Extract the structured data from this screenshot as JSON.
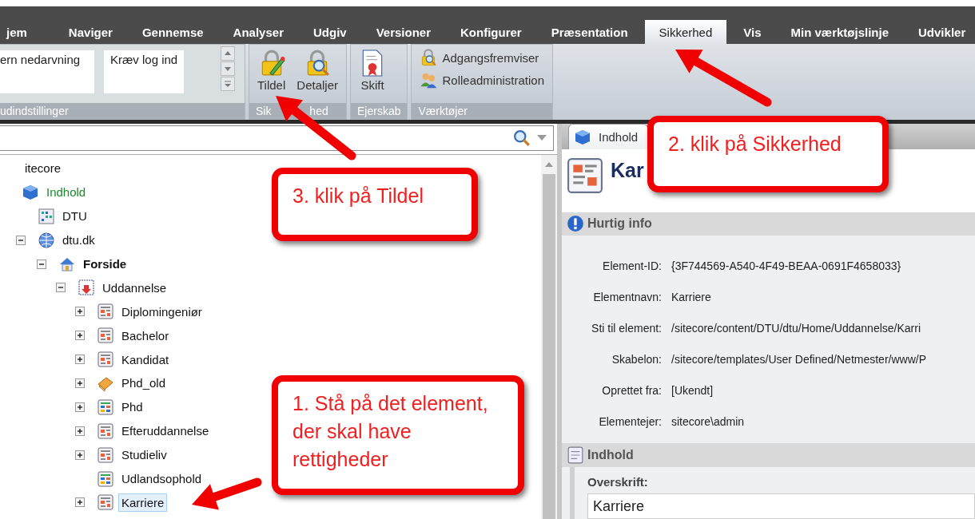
{
  "menu_tabs": [
    {
      "label": "jem",
      "selected": false
    },
    {
      "label": "Naviger",
      "selected": false
    },
    {
      "label": "Gennemse",
      "selected": false
    },
    {
      "label": "Analyser",
      "selected": false
    },
    {
      "label": "Udgiv",
      "selected": false
    },
    {
      "label": "Versioner",
      "selected": false
    },
    {
      "label": "Konfigurer",
      "selected": false
    },
    {
      "label": "Præsentation",
      "selected": false
    },
    {
      "label": "Sikkerhed",
      "selected": true
    },
    {
      "label": "Vis",
      "selected": false
    },
    {
      "label": "Min værktøjslinje",
      "selected": false
    },
    {
      "label": "Udvikler",
      "selected": false
    }
  ],
  "ribbon": {
    "gallery": {
      "items": [
        "ern nedarvning",
        "Kræv log ind"
      ],
      "group_label": "udindstillinger"
    },
    "groups": [
      {
        "label": "Sik",
        "label_end": "hed",
        "kind": "large",
        "buttons": [
          {
            "label": "Tildel",
            "kind": "lock-pencil"
          },
          {
            "label": "Detaljer",
            "kind": "lock-search"
          }
        ]
      },
      {
        "label": "Ejerskab",
        "kind": "large",
        "buttons": [
          {
            "label": "Skift",
            "kind": "certificate"
          }
        ]
      },
      {
        "label": "Værktøjer",
        "kind": "small",
        "buttons": [
          {
            "label": "Adgangsfremviser",
            "kind": "lock-search"
          },
          {
            "label": "Rolleadministration",
            "kind": "people"
          }
        ]
      }
    ]
  },
  "tree": [
    {
      "label": "itecore",
      "selected": false,
      "children": [
        {
          "label": "Indhold",
          "kind": "cube",
          "selected": false,
          "children": [
            {
              "label": "DTU",
              "kind": "grid",
              "selected": false
            },
            {
              "label": "dtu.dk",
              "kind": "globe",
              "expanded": true,
              "selected": false,
              "children": [
                {
                  "label": "Forside",
                  "kind": "house",
                  "expanded": true,
                  "selected": false,
                  "children": [
                    {
                      "label": "Uddannelse",
                      "kind": "folder",
                      "expanded": true,
                      "selected": false,
                      "children": [
                        {
                          "label": "Diplomingeniør",
                          "kind": "page",
                          "expanded": false,
                          "selected": false
                        },
                        {
                          "label": "Bachelor",
                          "kind": "page",
                          "expanded": false,
                          "selected": false
                        },
                        {
                          "label": "Kandidat",
                          "kind": "page",
                          "expanded": false,
                          "selected": false
                        },
                        {
                          "label": "Phd_old",
                          "kind": "book",
                          "expanded": false,
                          "selected": false
                        },
                        {
                          "label": "Phd",
                          "kind": "color-page",
                          "expanded": false,
                          "selected": false
                        },
                        {
                          "label": "Efteruddannelse",
                          "kind": "page",
                          "expanded": false,
                          "selected": false
                        },
                        {
                          "label": "Studieliv",
                          "kind": "page",
                          "expanded": false,
                          "selected": false
                        },
                        {
                          "label": "Udlandsophold",
                          "kind": "color-page",
                          "selected": false
                        },
                        {
                          "label": "Karriere",
                          "kind": "page",
                          "expanded": false,
                          "selected": true
                        }
                      ]
                    }
                  ]
                }
              ]
            }
          ]
        }
      ]
    }
  ],
  "editor": {
    "tabs": [
      {
        "label": "Indhold",
        "selected": true
      }
    ],
    "heading": "Kar",
    "sections": [
      {
        "title": "Hurtig info",
        "kind": "info",
        "fields": [
          {
            "label": "Element-ID:",
            "value": "{3F744569-A540-4F49-BEAA-0691F4658033}"
          },
          {
            "label": "Elementnavn:",
            "value": "Karriere"
          },
          {
            "label": "Sti til element:",
            "value": "/sitecore/content/DTU/dtu/Home/Uddannelse/Karri"
          },
          {
            "label": "Skabelon:",
            "value": "/sitecore/templates/User Defined/Netmester/www/P"
          },
          {
            "label": "Oprettet fra:",
            "value": "[Ukendt]"
          },
          {
            "label": "Elementejer:",
            "value": "sitecore\\admin"
          }
        ]
      },
      {
        "title": "Indhold",
        "kind": "content",
        "fields": [
          {
            "label": "Overskrift:",
            "value": "Karriere"
          }
        ]
      }
    ]
  },
  "callouts": [
    {
      "text": "1. Stå på det element, der skal have rettigheder"
    },
    {
      "text": "2. klik på Sikkerhed"
    },
    {
      "text": "3. klik på Tildel"
    }
  ]
}
